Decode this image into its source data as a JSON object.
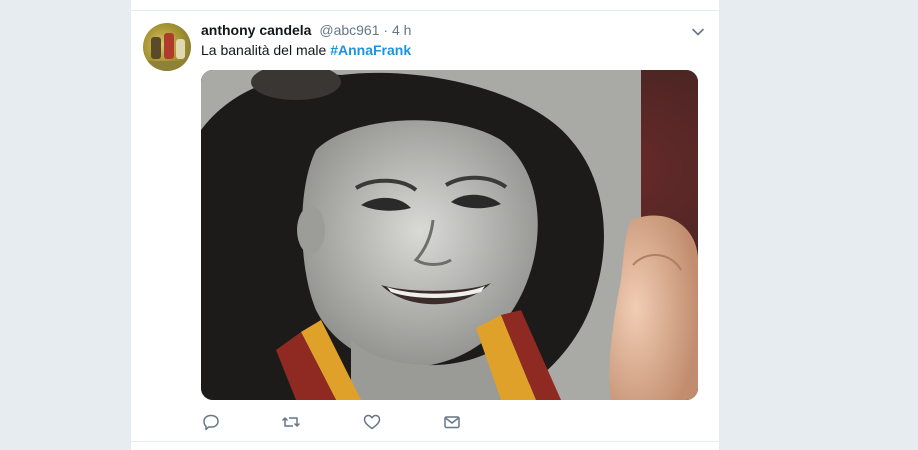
{
  "tweet": {
    "author_name": "anthony candela",
    "handle": "@abc961",
    "separator": "·",
    "time": "4 h",
    "text": "La banalità del male ",
    "hashtag": "#AnnaFrank"
  },
  "icons": {
    "caret": "chevron-down-icon",
    "reply": "reply-icon",
    "retweet": "retweet-icon",
    "like": "heart-icon",
    "dm": "envelope-icon"
  },
  "colors": {
    "background": "#e6ecf0",
    "card": "#ffffff",
    "text": "#14171a",
    "secondary": "#657786",
    "link": "#1b95e0"
  }
}
